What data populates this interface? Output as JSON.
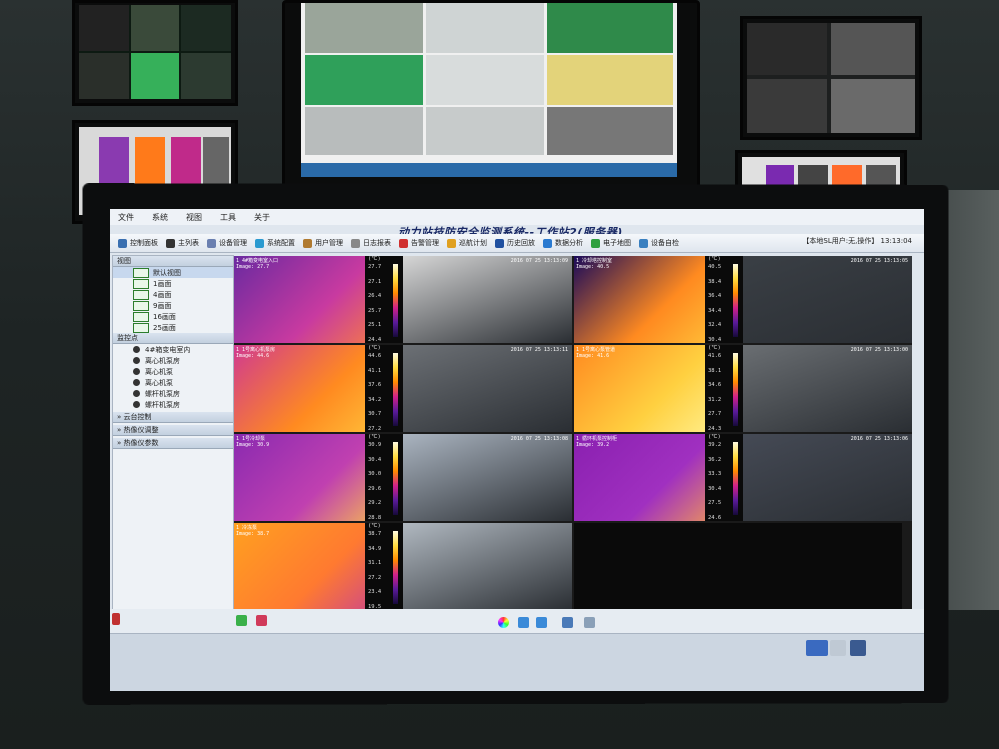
{
  "menu": [
    "文件",
    "系统",
    "视图",
    "工具",
    "关于"
  ],
  "app_title": "动力站技防安全监测系统--工作站2(服务器)",
  "toolbar": [
    {
      "label": "控制面板",
      "icon": "panel-icon",
      "color": "#3a6fb0"
    },
    {
      "label": "主列表",
      "icon": "list-icon",
      "color": "#333"
    },
    {
      "label": "设备管理",
      "icon": "device-icon",
      "color": "#6a7fb0"
    },
    {
      "label": "系统配置",
      "icon": "config-icon",
      "color": "#2a9ad0"
    },
    {
      "label": "用户管理",
      "icon": "user-icon",
      "color": "#b07a30"
    },
    {
      "label": "日志报表",
      "icon": "log-icon",
      "color": "#888"
    },
    {
      "label": "告警管理",
      "icon": "alarm-icon",
      "color": "#d03030"
    },
    {
      "label": "巡航计划",
      "icon": "cruise-icon",
      "color": "#e0a020"
    },
    {
      "label": "历史回放",
      "icon": "playback-icon",
      "color": "#2050a0"
    },
    {
      "label": "数据分析",
      "icon": "chart-icon",
      "color": "#2a7ad0"
    },
    {
      "label": "电子地图",
      "icon": "map-icon",
      "color": "#30a040"
    },
    {
      "label": "设备自检",
      "icon": "selfcheck-icon",
      "color": "#3a80c0"
    }
  ],
  "status": "【本地SL用户:无,操作】 13:13:04",
  "left_panel": {
    "view_header": "视图",
    "views": [
      "默认视图",
      "1画面",
      "4画面",
      "9画面",
      "16画面",
      "25画面"
    ],
    "monitor_header": "监控点",
    "points": [
      "4#箱变电室内",
      "离心机泵房",
      "离心机泵",
      "离心机泵",
      "螺杆机泵房",
      "螺杆机泵房"
    ],
    "sections": [
      "云台控制",
      "热像仪调整",
      "热像仪参数"
    ]
  },
  "ir_cells": [
    {
      "caption": "1 4#箱变电室入口",
      "image": "Image: 27.7",
      "scale": [
        "27.7",
        "27.1",
        "26.4",
        "25.7",
        "25.1",
        "24.4"
      ]
    },
    {
      "caption": "1 冷却塔控制室",
      "image": "Image: 40.5",
      "scale": [
        "40.5",
        "38.4",
        "36.4",
        "34.4",
        "32.4",
        "30.4"
      ]
    },
    {
      "caption": "1 1号离心机泵房",
      "image": "Image: 44.6",
      "scale": [
        "44.6",
        "41.1",
        "37.6",
        "34.2",
        "30.7",
        "27.2"
      ]
    },
    {
      "caption": "1 1号离心泵管道",
      "image": "Image: 41.6",
      "scale": [
        "41.6",
        "38.1",
        "34.6",
        "31.2",
        "27.7",
        "24.3"
      ]
    },
    {
      "caption": "1 1号冷却泵",
      "image": "Image: 30.9",
      "scale": [
        "30.9",
        "30.4",
        "30.0",
        "29.6",
        "29.2",
        "28.8"
      ]
    },
    {
      "caption": "1 循环机泵控制柜",
      "image": "Image: 39.2",
      "scale": [
        "39.2",
        "36.2",
        "33.3",
        "30.4",
        "27.5",
        "24.6"
      ]
    },
    {
      "caption": "1 冷冻泵",
      "image": "Image: 38.7",
      "scale": [
        "38.7",
        "34.9",
        "31.1",
        "27.2",
        "23.4",
        "19.5"
      ]
    }
  ],
  "cam_timestamps": [
    "2016 07 25 13:13:09",
    "2016 07 25 13:13:05",
    "2016 07 25 13:13:11",
    "2016 07 25 13:13:00",
    "2016 07 25 13:13:08",
    "2016 07 25 13:13:06"
  ]
}
